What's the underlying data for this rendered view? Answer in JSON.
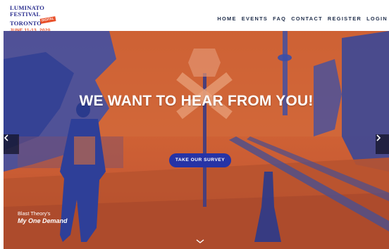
{
  "brand": {
    "line1": "LUMINATO",
    "line2": "FESTIVAL",
    "line3": "TORONTO",
    "badge": "DIGITAL",
    "dates": "JUNE 11-13, 2020"
  },
  "nav": {
    "items": [
      "HOME",
      "EVENTS",
      "FAQ",
      "CONTACT",
      "REGISTER",
      "LOGIN"
    ]
  },
  "hero": {
    "headline": "WE WANT TO HEAR FROM YOU!",
    "cta_label": "TAKE OUR SURVEY",
    "caption_line1": "Blast Theory's",
    "caption_line2": "My One Demand",
    "icons": {
      "prev": "chevron-left-icon",
      "next": "chevron-right-icon",
      "scroll": "chevron-down-icon"
    }
  },
  "colors": {
    "brand_blue": "#2b2f8f",
    "brand_orange": "#e8502a",
    "cta_blue": "#2633a6",
    "hero_orange": "#c8542a",
    "hero_blue": "#3a4fa8"
  }
}
